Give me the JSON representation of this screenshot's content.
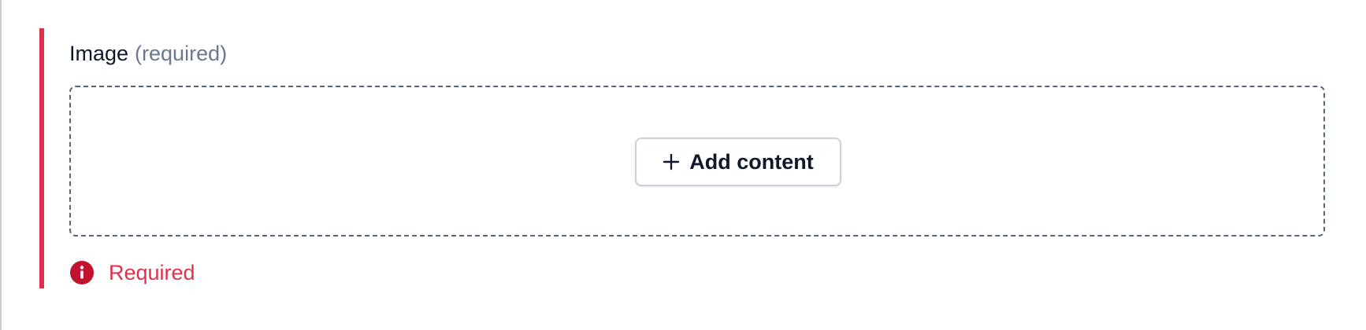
{
  "field": {
    "label": "Image",
    "required_hint": "(required)",
    "add_button_label": "Add content",
    "error_message": "Required"
  },
  "icons": {
    "add": "plus-icon",
    "error": "info-icon"
  },
  "colors": {
    "error": "#e0304e",
    "error_icon": "#c1122f",
    "text": "#0f172a",
    "muted": "#6b7790",
    "dashed_border": "#5a6478"
  }
}
